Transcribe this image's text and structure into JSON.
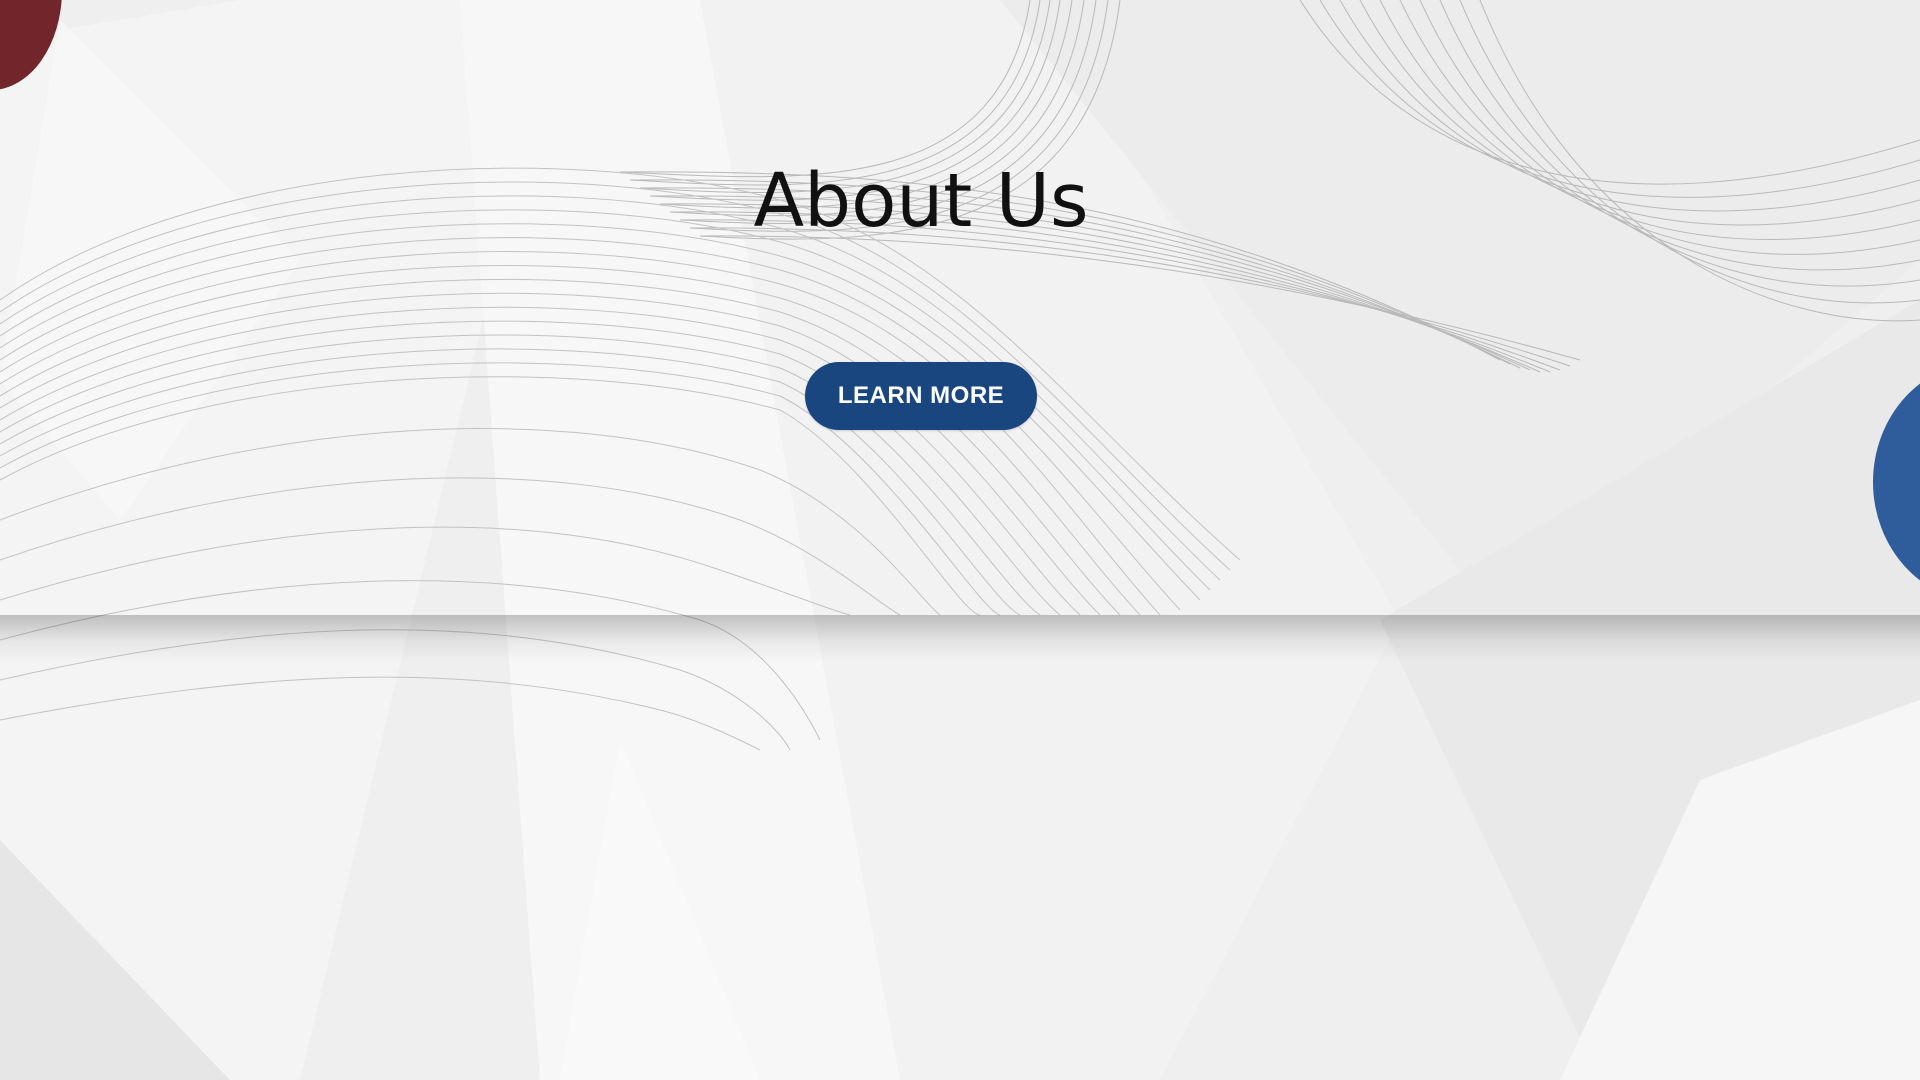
{
  "hero": {
    "title": "About Us",
    "button_label": "LEARN MORE"
  },
  "colors": {
    "button_bg": "#1a4680",
    "red_accent": "#72252a",
    "blue_accent": "#2f5d9b",
    "background": "#efefef"
  }
}
